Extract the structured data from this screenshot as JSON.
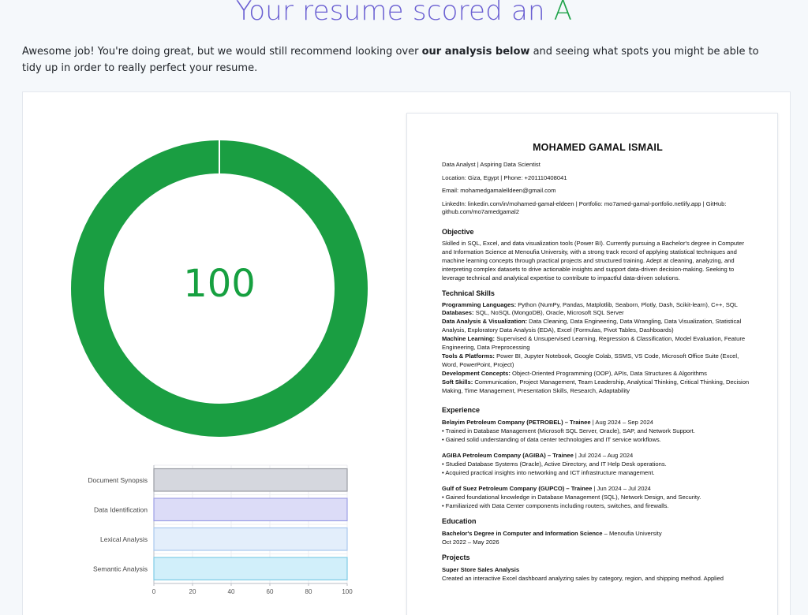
{
  "header": {
    "title_prefix": "Your resume scored an",
    "grade": "A"
  },
  "intro": {
    "before_bold": "Awesome job! You're doing great, but we would still recommend looking over ",
    "bold": "our analysis below",
    "after_bold": " and seeing what spots you might be able to tidy up in order to really perfect your resume."
  },
  "score": {
    "value": "100",
    "fraction": 1.0
  },
  "colors": {
    "accent": "#6a5fd2",
    "green": "#1a9e42",
    "bar_fills": [
      "#d5d7de",
      "#dcdcf7",
      "#e3eefb",
      "#d1effa"
    ],
    "bar_strokes": [
      "#9a9ca4",
      "#9d9fe6",
      "#a9c8ee",
      "#7fcbe6"
    ]
  },
  "chart_data": {
    "type": "bar",
    "orientation": "horizontal",
    "categories": [
      "Document Synopsis",
      "Data Identification",
      "Lexical Analysis",
      "Semantic Analysis"
    ],
    "values": [
      100,
      100,
      100,
      100
    ],
    "xlim": [
      0,
      100
    ],
    "xticks": [
      "0",
      "20",
      "40",
      "60",
      "80",
      "100"
    ],
    "grid": true
  },
  "resume": {
    "name": "MOHAMED GAMAL ISMAIL",
    "headline": "Data Analyst | Aspiring Data Scientist",
    "location": "Location: Giza, Egypt | Phone: +201110408041",
    "email": "Email: mohamedgamalelldeen@gmail.com",
    "links": "LinkedIn: linkedin.com/in/mohamed-gamal-eldeen | Portfolio: mo7amed-gamal-portfolio.netlify.app | GitHub: github.com/mo7amedgamal2",
    "objective_title": "Objective",
    "objective": "Skilled in SQL, Excel, and data visualization tools (Power BI). Currently pursuing a Bachelor's degree in Computer and Information Science at Menoufia University, with a strong track record of applying statistical techniques and machine learning concepts through practical projects and structured training. Adept at cleaning, analyzing, and interpreting complex datasets to drive actionable insights and support data-driven decision-making. Seeking to leverage technical and analytical expertise to contribute to impactful data-driven solutions.",
    "skills_title": "Technical Skills",
    "skills": [
      {
        "label": "Programming Languages:",
        "text": " Python (NumPy, Pandas, Matplotlib, Seaborn, Plotly, Dash, Scikit-learn), C++, SQL"
      },
      {
        "label": "Databases:",
        "text": " SQL, NoSQL (MongoDB), Oracle, Microsoft SQL Server"
      },
      {
        "label": "Data Analysis & Visualization:",
        "text": " Data Cleaning, Data Engineering, Data Wrangling, Data Visualization, Statistical Analysis, Exploratory Data Analysis (EDA), Excel (Formulas, Pivot Tables, Dashboards)"
      },
      {
        "label": "Machine Learning:",
        "text": " Supervised & Unsupervised Learning, Regression & Classification, Model Evaluation, Feature Engineering, Data Preprocessing"
      },
      {
        "label": "Tools & Platforms:",
        "text": " Power BI, Jupyter Notebook, Google Colab, SSMS, VS Code, Microsoft Office Suite (Excel, Word, PowerPoint, Project)"
      },
      {
        "label": "Development Concepts:",
        "text": " Object-Oriented Programming (OOP), APIs, Data Structures & Algorithms"
      },
      {
        "label": "Soft Skills:",
        "text": " Communication, Project Management, Team Leadership, Analytical Thinking, Critical Thinking, Decision Making, Time Management, Presentation Skills, Research, Adaptability"
      }
    ],
    "experience_title": "Experience",
    "experience": [
      {
        "title": "Belayim Petroleum Company (PETROBEL) – Trainee",
        "date": " | Aug 2024 – Sep 2024",
        "bullets": [
          "• Trained in Database Management (Microsoft SQL Server, Oracle), SAP, and Network Support.",
          "• Gained solid understanding of data center technologies and IT service workflows."
        ]
      },
      {
        "title": "AGIBA Petroleum Company (AGIBA) – Trainee",
        "date": " | Jul 2024 – Aug 2024",
        "bullets": [
          "• Studied Database Systems (Oracle), Active Directory, and IT Help Desk operations.",
          "• Acquired practical insights into networking and ICT infrastructure management."
        ]
      },
      {
        "title": "Gulf of Suez Petroleum Company (GUPCO) – Trainee",
        "date": " | Jun 2024 – Jul 2024",
        "bullets": [
          "• Gained foundational knowledge in Database Management (SQL), Network Design, and Security.",
          "• Familiarized with Data Center components including routers, switches, and firewalls."
        ]
      }
    ],
    "education_title": "Education",
    "education_degree": "Bachelor's Degree in Computer and Information Science",
    "education_school": " – Menoufia University",
    "education_dates": "Oct 2022 – May 2026",
    "projects_title": "Projects",
    "project_name": "Super Store Sales Analysis",
    "project_desc": "Created an interactive Excel dashboard analyzing sales by category, region, and shipping method. Applied"
  }
}
